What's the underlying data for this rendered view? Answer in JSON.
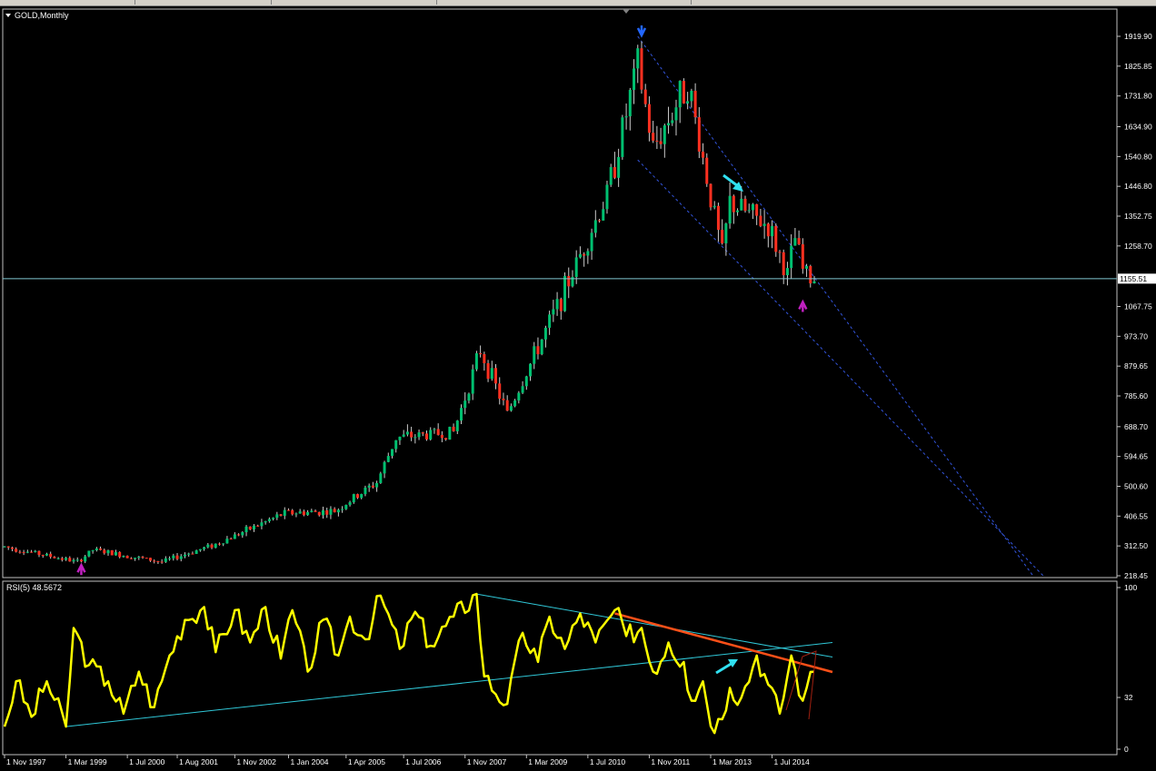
{
  "chart_data": [
    {
      "type": "candlestick",
      "title": "GOLD,Monthly",
      "price_ticks": [
        "1919.90",
        "1825.85",
        "1731.80",
        "1634.90",
        "1540.80",
        "1446.80",
        "1352.75",
        "1258.70",
        "1067.75",
        "973.70",
        "879.65",
        "785.60",
        "688.70",
        "594.65",
        "500.60",
        "406.55",
        "312.50",
        "218.45"
      ],
      "current_price": "1155.51",
      "ylim": [
        218.45,
        1919.9
      ],
      "date_ticks": [
        "1 Nov 1997",
        "1 Mar 1999",
        "1 Jul 2000",
        "1 Aug 2001",
        "1 Nov 2002",
        "1 Jan 2004",
        "1 Apr 2005",
        "1 Jul 2006",
        "1 Nov 2007",
        "1 Mar 2009",
        "1 Jul 2010",
        "1 Nov 2011",
        "1 Mar 2013",
        "1 Jul 2014"
      ],
      "x_range": [
        "1997-11",
        "2015-06"
      ],
      "key_points": [
        {
          "date": "1997-11",
          "close": 310
        },
        {
          "date": "1999-06",
          "close": 262
        },
        {
          "date": "1999-10",
          "close": 300
        },
        {
          "date": "2001-04",
          "close": 262
        },
        {
          "date": "2002-06",
          "close": 318
        },
        {
          "date": "2003-12",
          "close": 416
        },
        {
          "date": "2005-01",
          "close": 422
        },
        {
          "date": "2005-12",
          "close": 513
        },
        {
          "date": "2006-05",
          "close": 654
        },
        {
          "date": "2007-08",
          "close": 672
        },
        {
          "date": "2008-03",
          "close": 930
        },
        {
          "date": "2008-10",
          "close": 730
        },
        {
          "date": "2009-12",
          "close": 1095
        },
        {
          "date": "2010-12",
          "close": 1420
        },
        {
          "date": "2011-08",
          "close": 1830
        },
        {
          "date": "2011-12",
          "close": 1565
        },
        {
          "date": "2012-09",
          "close": 1775
        },
        {
          "date": "2013-06",
          "close": 1232
        },
        {
          "date": "2013-08",
          "close": 1396
        },
        {
          "date": "2014-06",
          "close": 1322
        },
        {
          "date": "2014-11",
          "close": 1167
        },
        {
          "date": "2015-01",
          "close": 1283
        },
        {
          "date": "2015-03",
          "close": 1183
        },
        {
          "date": "2015-05",
          "close": 1155
        }
      ],
      "events": [
        {
          "date": "2011-09",
          "price": 1920,
          "kind": "down-arrow"
        },
        {
          "date": "2015-03",
          "price": 1085,
          "kind": "up-arrow"
        },
        {
          "date": "1999-07",
          "price": 255,
          "kind": "up-arrow"
        }
      ],
      "channel": {
        "upper": [
          {
            "date": "2011-08",
            "price": 1919.9
          },
          {
            "date": "2015-06",
            "price": 1160
          }
        ],
        "lower": [
          {
            "date": "2011-08",
            "price": 1530
          },
          {
            "date": "2014-01",
            "price": 1170
          }
        ]
      },
      "colors": {
        "up": "#00c070",
        "down": "#ff3020",
        "wick": "#cccccc",
        "channel": "#3355dd",
        "hline": "#80c8d0"
      }
    },
    {
      "type": "line",
      "title": "RSI(5) 48.5672",
      "ylim": [
        0,
        100
      ],
      "ticks": [
        "100",
        "32",
        "0"
      ],
      "points": [
        {
          "date": "1997-11",
          "v": 14
        },
        {
          "date": "1998-02",
          "v": 42
        },
        {
          "date": "1998-06",
          "v": 20
        },
        {
          "date": "1998-10",
          "v": 42
        },
        {
          "date": "1999-03",
          "v": 14
        },
        {
          "date": "1999-05",
          "v": 75
        },
        {
          "date": "1999-09",
          "v": 52
        },
        {
          "date": "2000-02",
          "v": 42
        },
        {
          "date": "2000-06",
          "v": 22
        },
        {
          "date": "2000-10",
          "v": 48
        },
        {
          "date": "2001-02",
          "v": 26
        },
        {
          "date": "2001-06",
          "v": 58
        },
        {
          "date": "2001-10",
          "v": 80
        },
        {
          "date": "2002-03",
          "v": 88
        },
        {
          "date": "2002-06",
          "v": 60
        },
        {
          "date": "2002-11",
          "v": 86
        },
        {
          "date": "2003-03",
          "v": 66
        },
        {
          "date": "2003-07",
          "v": 88
        },
        {
          "date": "2003-11",
          "v": 56
        },
        {
          "date": "2004-02",
          "v": 86
        },
        {
          "date": "2004-06",
          "v": 48
        },
        {
          "date": "2004-10",
          "v": 80
        },
        {
          "date": "2005-02",
          "v": 58
        },
        {
          "date": "2005-05",
          "v": 82
        },
        {
          "date": "2005-09",
          "v": 68
        },
        {
          "date": "2006-01",
          "v": 95
        },
        {
          "date": "2006-06",
          "v": 62
        },
        {
          "date": "2006-10",
          "v": 85
        },
        {
          "date": "2007-02",
          "v": 64
        },
        {
          "date": "2007-08",
          "v": 82
        },
        {
          "date": "2008-02",
          "v": 96
        },
        {
          "date": "2008-04",
          "v": 45
        },
        {
          "date": "2008-10",
          "v": 28
        },
        {
          "date": "2009-02",
          "v": 72
        },
        {
          "date": "2009-06",
          "v": 54
        },
        {
          "date": "2009-09",
          "v": 82
        },
        {
          "date": "2010-01",
          "v": 62
        },
        {
          "date": "2010-05",
          "v": 84
        },
        {
          "date": "2010-09",
          "v": 66
        },
        {
          "date": "2011-02",
          "v": 86
        },
        {
          "date": "2011-05",
          "v": 70
        },
        {
          "date": "2011-09",
          "v": 75
        },
        {
          "date": "2011-12",
          "v": 48
        },
        {
          "date": "2012-04",
          "v": 66
        },
        {
          "date": "2012-08",
          "v": 54
        },
        {
          "date": "2012-10",
          "v": 30
        },
        {
          "date": "2013-01",
          "v": 42
        },
        {
          "date": "2013-04",
          "v": 10
        },
        {
          "date": "2013-08",
          "v": 38
        },
        {
          "date": "2013-11",
          "v": 32
        },
        {
          "date": "2014-03",
          "v": 58
        },
        {
          "date": "2014-06",
          "v": 40
        },
        {
          "date": "2014-09",
          "v": 22
        },
        {
          "date": "2014-12",
          "v": 58
        },
        {
          "date": "2015-03",
          "v": 30
        },
        {
          "date": "2015-04",
          "v": 38
        },
        {
          "date": "2015-06",
          "v": 48
        }
      ],
      "trendlines": [
        {
          "from": {
            "date": "1999-03",
            "v": 14
          },
          "to": {
            "date": "2015-06",
            "v": 66
          },
          "color": "#30c8d8"
        },
        {
          "from": {
            "date": "2008-02",
            "v": 96
          },
          "to": {
            "date": "2015-06",
            "v": 57
          },
          "color": "#30c8d8"
        },
        {
          "from": {
            "date": "2011-02",
            "v": 84
          },
          "to": {
            "date": "2015-06",
            "v": 50
          },
          "color": "#ff5018"
        }
      ],
      "colors": {
        "line": "#ffff00"
      }
    }
  ]
}
